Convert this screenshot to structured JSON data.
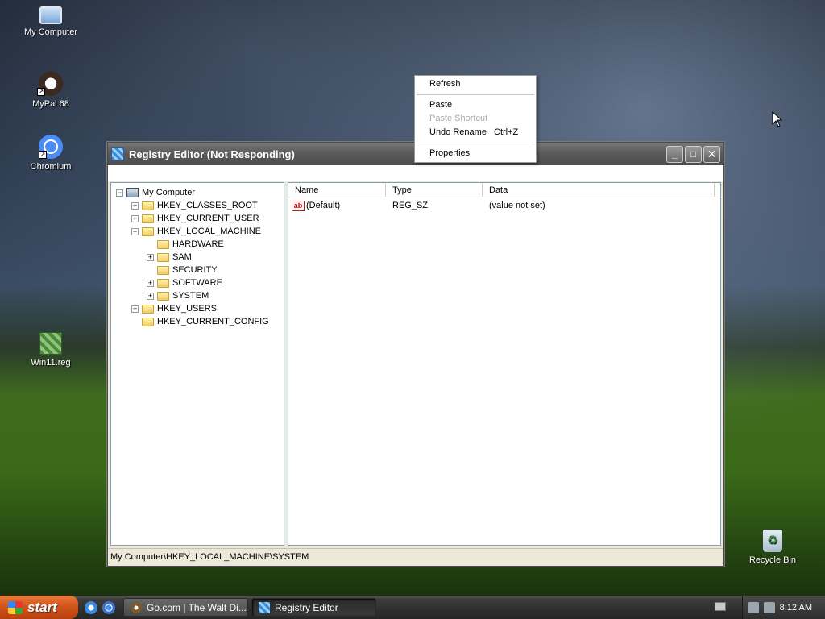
{
  "desktop": {
    "icons": [
      {
        "label": "My Computer"
      },
      {
        "label": "MyPal 68"
      },
      {
        "label": "Chromium"
      },
      {
        "label": "Win11.reg"
      },
      {
        "label": "Recycle Bin"
      }
    ]
  },
  "window": {
    "title": "Registry Editor (Not Responding)",
    "buttons": {
      "minimize": "_",
      "maximize": "□",
      "close": "✕"
    },
    "tree": {
      "root": "My Computer",
      "items": [
        {
          "label": "HKEY_CLASSES_ROOT",
          "expander": "+"
        },
        {
          "label": "HKEY_CURRENT_USER",
          "expander": "+"
        },
        {
          "label": "HKEY_LOCAL_MACHINE",
          "expander": "−"
        },
        {
          "label": "HARDWARE",
          "expander": ""
        },
        {
          "label": "SAM",
          "expander": "+"
        },
        {
          "label": "SECURITY",
          "expander": ""
        },
        {
          "label": "SOFTWARE",
          "expander": "+"
        },
        {
          "label": "SYSTEM",
          "expander": "+"
        },
        {
          "label": "HKEY_USERS",
          "expander": "+"
        },
        {
          "label": "HKEY_CURRENT_CONFIG",
          "expander": ""
        }
      ],
      "root_expander": "−"
    },
    "list": {
      "columns": [
        "Name",
        "Type",
        "Data"
      ],
      "rows": [
        {
          "icon": "ab",
          "name": "(Default)",
          "type": "REG_SZ",
          "data": "(value not set)"
        }
      ]
    },
    "status": "My Computer\\HKEY_LOCAL_MACHINE\\SYSTEM"
  },
  "context_menu": {
    "items": [
      {
        "label": "Refresh",
        "disabled": false,
        "shortcut": ""
      },
      {
        "label": "Paste",
        "disabled": false,
        "shortcut": ""
      },
      {
        "label": "Paste Shortcut",
        "disabled": true,
        "shortcut": ""
      },
      {
        "label": "Undo Rename",
        "disabled": false,
        "shortcut": "Ctrl+Z"
      },
      {
        "label": "Properties",
        "disabled": false,
        "shortcut": ""
      }
    ]
  },
  "taskbar": {
    "start_label": "start",
    "tasks": [
      {
        "label": "Go.com | The Walt Di...",
        "icon": "go-icon",
        "active": false
      },
      {
        "label": "Registry Editor",
        "icon": "registry-icon",
        "active": true
      }
    ],
    "clock": "8:12 AM"
  },
  "colors": {
    "titlebar": "#5d5d5d",
    "start_button": "#d2541c",
    "tree_border": "#7f9db9"
  }
}
